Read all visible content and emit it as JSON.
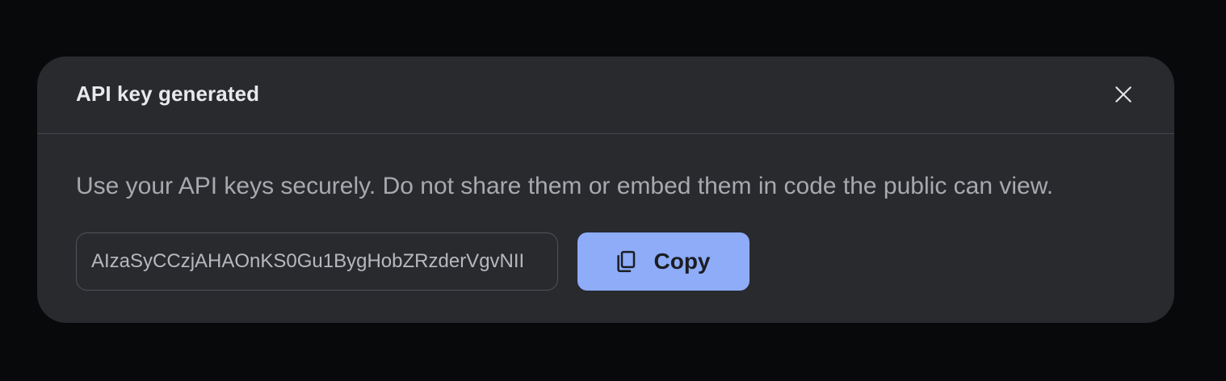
{
  "dialog": {
    "title": "API key generated",
    "message": "Use your API keys securely. Do not share them or embed them in code the public can view.",
    "api_key_value": "AIzaSyCCzjAHAOnKS0Gu1BygHobZRzderVgvNII",
    "copy_label": "Copy",
    "close_icon": "close-icon",
    "copy_icon": "copy-icon"
  },
  "colors": {
    "background": "#08090b",
    "dialog_surface": "#292a2e",
    "accent_button": "#8eacf8",
    "divider": "#44464c"
  }
}
